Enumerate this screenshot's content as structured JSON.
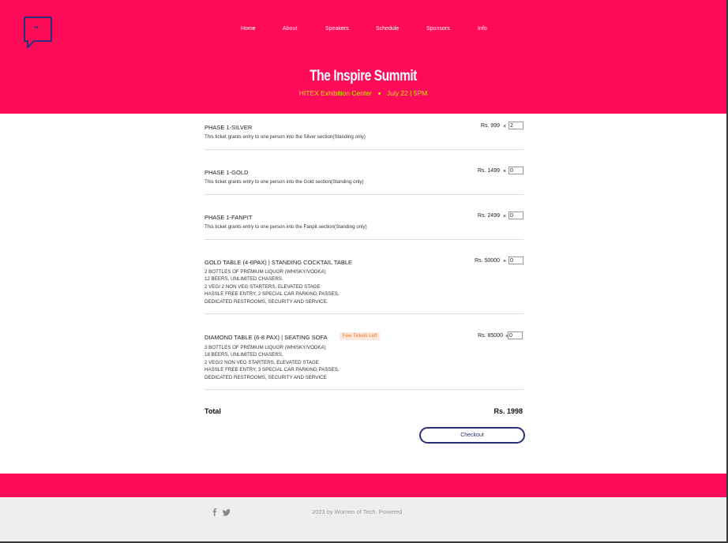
{
  "nav": [
    "Home",
    "About",
    "Speakers",
    "Schedule",
    "Sponsors",
    "Info"
  ],
  "event": {
    "title": "The Inspire Summit",
    "venue": "HITEX Exhibition Center",
    "date": "July 22 | 5PM"
  },
  "tickets": [
    {
      "name": "PHASE 1-SILVER",
      "desc": "This ticket grants entry to one person into the Silver section(Standing only)",
      "price": "Rs. 999",
      "qty": "2"
    },
    {
      "name": "PHASE 1-GOLD",
      "desc": "This ticket grants entry to one person into the Gold section(Standing only)",
      "price": "Rs. 1499",
      "qty": "0"
    },
    {
      "name": "PHASE 1-FANPIT",
      "desc": "This ticket grants entry to one person into the Fanpit section(Standing only)",
      "price": "Rs. 2499",
      "qty": "0"
    },
    {
      "name": "GOLD TABLE (4-6PAX) | STANDING COCKTAIL TABLE",
      "desc": "2 BOTTLES OF PREMIUM LIQUOR (WHISKY/VODKA)\n12 BEERS, UNLIMITED CHASERS.\n2 VEG/ 2 NON VEG STARTERS, ELEVATED STAGE\nHASSLE FREE ENTRY, 2 SPECIAL CAR PARKING PASSES,\nDEDICATED RESTROOMS, SECURITY AND SERVICE.",
      "price": "Rs. 50000",
      "qty": "0"
    },
    {
      "name": "DIAMOND TABLE (6-8 PAX) | SEATING SOFA",
      "badge": "Few Tickets Left",
      "desc": "3 BOTTLES OF PREMIUM LIQUOR (WHISKY/VODKA)\n18 BEERS, UNLIMITED CHASERS,\n2 VEG/2 NON VEG STARTERS, ELEVATED STAGE\nHASSLE FREE ENTRY, 3 SPECIAL CAR PARKING PASSES,\nDEDICATED RESTROOMS, SECURITY AND SERVICE",
      "price": "Rs. 85000",
      "qty": "0"
    }
  ],
  "qty_separator": "×",
  "total": {
    "label": "Total",
    "value": "Rs. 1998"
  },
  "checkout_label": "Checkout",
  "footer": {
    "copyright": "2023 by Women of Tech. Powered",
    "icons": [
      "facebook-icon",
      "twitter-icon"
    ]
  },
  "colors": {
    "brand": "#fe0b5a",
    "accent": "#c9f000",
    "button": "#2a3178",
    "badge_text": "#e8722d",
    "badge_bg": "#fde9dc"
  }
}
